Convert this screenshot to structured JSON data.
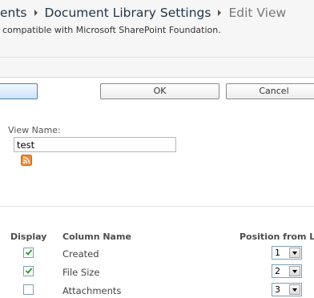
{
  "breadcrumb": {
    "items": [
      {
        "label": "ents"
      },
      {
        "label": "Document Library Settings"
      }
    ],
    "current": "Edit View"
  },
  "header": {
    "subtitle": "compatible with Microsoft SharePoint Foundation."
  },
  "toolbar": {
    "ok_label": "OK",
    "cancel_label": "Cancel"
  },
  "name_section": {
    "label": "View Name:",
    "value": "test",
    "rss_icon": "rss-feed-icon"
  },
  "columns": {
    "headers": {
      "display": "Display",
      "name": "Column Name",
      "position": "Position from Left"
    },
    "rows": [
      {
        "name": "Created",
        "checked": true,
        "position": "1"
      },
      {
        "name": "File Size",
        "checked": true,
        "position": "2"
      },
      {
        "name": "Attachments",
        "checked": false,
        "position": "3"
      }
    ]
  },
  "colors": {
    "breadcrumb_link": "#21374c",
    "breadcrumb_current": "#777777",
    "header_bg": "#f6f6f6",
    "rss_orange": "#f58a2a"
  }
}
